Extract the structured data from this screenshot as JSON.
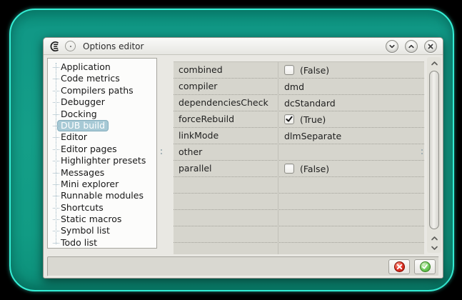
{
  "titlebar": {
    "title": "Options editor",
    "app_icon": "coedit-logo",
    "menu_button": "window-menu-button",
    "buttons": [
      {
        "name": "shade-button",
        "icon": "chevron-down"
      },
      {
        "name": "unshade-button",
        "icon": "chevron-up"
      },
      {
        "name": "close-button",
        "icon": "close"
      }
    ]
  },
  "sidebar": {
    "items": [
      {
        "label": "Application",
        "selected": false
      },
      {
        "label": "Code metrics",
        "selected": false
      },
      {
        "label": "Compilers paths",
        "selected": false
      },
      {
        "label": "Debugger",
        "selected": false
      },
      {
        "label": "Docking",
        "selected": false
      },
      {
        "label": "DUB build",
        "selected": true
      },
      {
        "label": "Editor",
        "selected": false
      },
      {
        "label": "Editor pages",
        "selected": false
      },
      {
        "label": "Highlighter presets",
        "selected": false
      },
      {
        "label": "Messages",
        "selected": false
      },
      {
        "label": "Mini explorer",
        "selected": false
      },
      {
        "label": "Runnable modules",
        "selected": false
      },
      {
        "label": "Shortcuts",
        "selected": false
      },
      {
        "label": "Static macros",
        "selected": false
      },
      {
        "label": "Symbol list",
        "selected": false
      },
      {
        "label": "Todo list",
        "selected": false
      }
    ]
  },
  "grid": {
    "rows": [
      {
        "name": "combined",
        "kind": "bool",
        "checked": false,
        "value": "(False)"
      },
      {
        "name": "compiler",
        "kind": "text",
        "value": "dmd"
      },
      {
        "name": "dependenciesCheck",
        "kind": "text",
        "value": "dcStandard"
      },
      {
        "name": "forceRebuild",
        "kind": "bool",
        "checked": true,
        "value": "(True)"
      },
      {
        "name": "linkMode",
        "kind": "text",
        "value": "dlmSeparate"
      },
      {
        "name": "other",
        "kind": "text",
        "value": ""
      },
      {
        "name": "parallel",
        "kind": "bool",
        "checked": false,
        "value": "(False)"
      }
    ],
    "empty_rows": 5
  },
  "scrollbar": {
    "icons": [
      "chevron-up",
      "chevron-up",
      "chevron-down"
    ]
  },
  "footer": {
    "buttons": [
      {
        "name": "cancel-button",
        "icon": "red-cross-circle"
      },
      {
        "name": "accept-button",
        "icon": "green-check-circle"
      }
    ]
  },
  "colors": {
    "frame_teal": "#149e88",
    "frame_edge": "#35eed5",
    "selection_blue": "#a7c9d5",
    "cancel_red": "#cf2213",
    "accept_green": "#53b542",
    "grid_bg": "#d6d5cd"
  }
}
